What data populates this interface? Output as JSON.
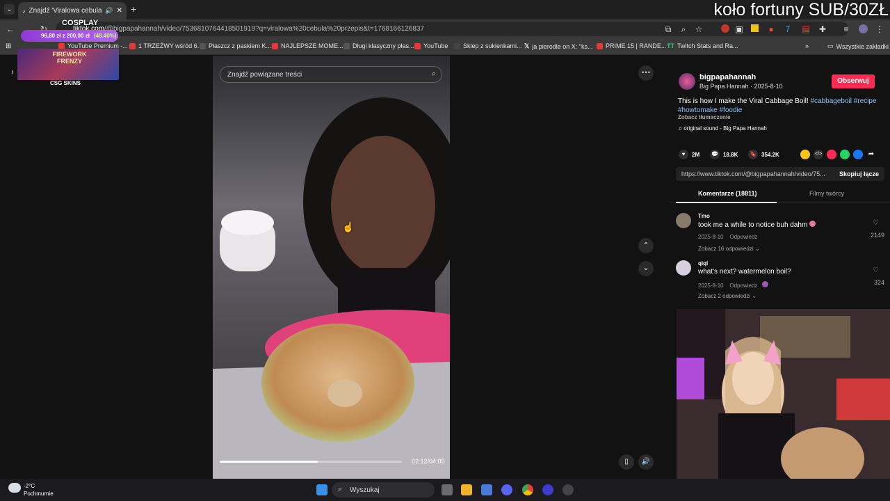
{
  "browser": {
    "tab_title": "Znajdź 'Viralowa cebula prz...",
    "overlay_title": "koło fortuny SUB/30ZŁ",
    "url_domain": "tiktok.com",
    "url_path": "/@bigpapahannah/video/7536810764418501919?q=viralowa%20cebula%20przepis&t=1768166126837",
    "bookmarks": [
      "YouTube Premium -...",
      "1 TRZEŹWY wśród 6...",
      "Płaszcz z paskiem K...",
      "NAJLEPSZE MOME...",
      "Długi klasyczny płas...",
      "YouTube",
      "Sklep z sukienkami...",
      "ja pierodle on X: \"ks...",
      "PRIME 15 | RANDE...",
      "Twitch Stats and Ra...",
      "Wszystkie zakładki"
    ]
  },
  "overlay_widget": {
    "label": "COSPLAY",
    "goal": "96,80 zł z 200,00 zł",
    "percent": "(48.40%)",
    "banner": "FIREWORK FRENZY",
    "sponsor": "CSG SKINS"
  },
  "video": {
    "search_placeholder": "Znajdź powiązane treści",
    "time": "02:12/04:05",
    "progress": 0.54
  },
  "author": {
    "handle": "bigpapahannah",
    "subline": "Big Papa Hannah · 2025-8-10",
    "follow_label": "Obserwuj"
  },
  "description": {
    "text": "This is how I make the Viral Cabbage Boil!",
    "hashtags": [
      "#cabbageboil",
      "#recipe",
      "#howtomake",
      "#foodie"
    ],
    "translate": "Zobacz tłumaczenie",
    "sound": "original sound - Big Papa Hannah"
  },
  "stats": {
    "likes": "2M",
    "comments": "18.8K",
    "saves": "354.2K"
  },
  "link": {
    "url": "https://www.tiktok.com/@bigpapahannah/video/75...",
    "copy_label": "Skopiuj łącze"
  },
  "tabs": {
    "comments": "Komentarze (18811)",
    "creator_videos": "Filmy twórcy"
  },
  "comments": [
    {
      "user": "Tmo",
      "text": "took me a while to notice buh dahm",
      "date": "2025-8-10",
      "reply": "Odpowiedz",
      "more": "Zobacz 16 odpowiedzi",
      "likes": "2149"
    },
    {
      "user": "qiqi",
      "text": "what's next? watermelon boil?",
      "date": "2025-8-10",
      "reply": "Odpowiedz",
      "more": "Zobacz 2 odpowiedzi",
      "likes": "324"
    }
  ],
  "taskbar": {
    "weather_temp": "-2°C",
    "weather_desc": "Pochmurnie",
    "search_label": "Wyszukaj"
  },
  "colors": {
    "follow": "#fe2c55",
    "hashtag": "#8ec5ff"
  }
}
